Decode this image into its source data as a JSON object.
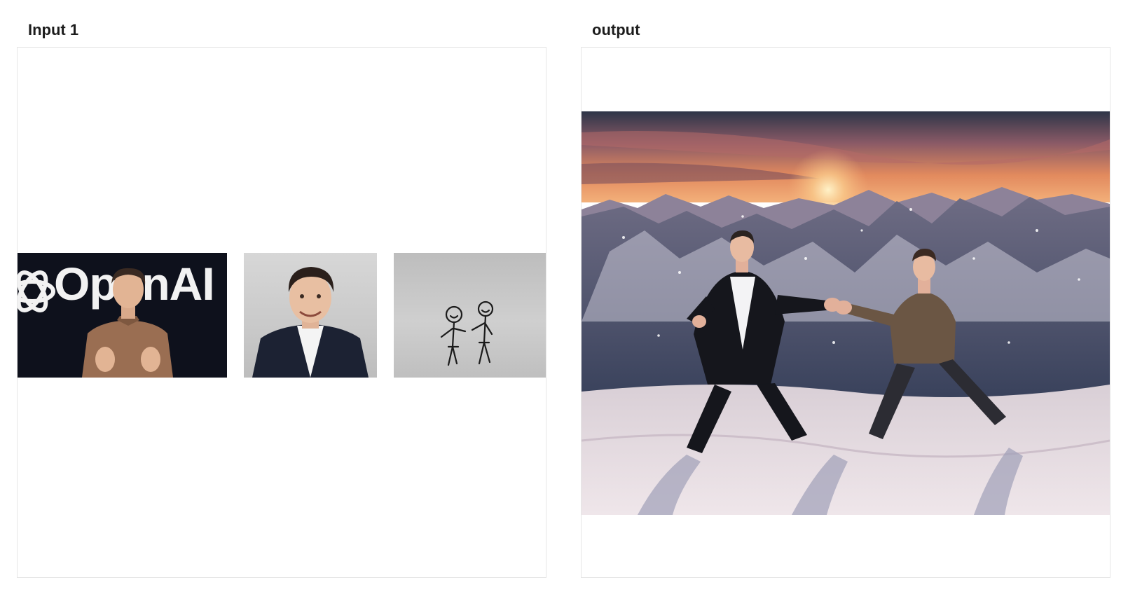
{
  "panels": {
    "input": {
      "label": "Input 1"
    },
    "output": {
      "label": "output"
    }
  },
  "input_images": {
    "openai": {
      "logo_text": "OpenAI",
      "description_icon": "photo-speaker-on-stage"
    },
    "portrait": {
      "description_icon": "photo-portrait-man-in-suit"
    },
    "sketch": {
      "description_icon": "drawing-two-stick-figures"
    }
  },
  "output_image": {
    "description_icon": "photo-two-men-on-snowy-mountain-at-sunset"
  },
  "colors": {
    "label_text": "#1c1c1c",
    "frame_border": "#e6e6e6",
    "openai_bg": "#0e111c",
    "sky_glow": "#f7a75c"
  }
}
